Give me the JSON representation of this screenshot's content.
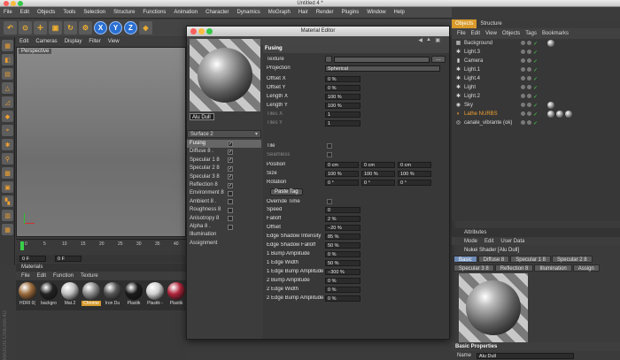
{
  "window": {
    "title": "Untitled 4 *"
  },
  "menubar": [
    "File",
    "Edit",
    "Objects",
    "Tools",
    "Selection",
    "Structure",
    "Functions",
    "Animation",
    "Character",
    "Dynamics",
    "MoGraph",
    "Hair",
    "Render",
    "Plugins",
    "Window",
    "Help"
  ],
  "toolbar": {
    "axis_x": "X",
    "axis_y": "Y",
    "axis_z": "Z"
  },
  "viewport": {
    "menu": [
      "Edit",
      "Cameras",
      "Display",
      "Filter",
      "View"
    ],
    "label": "Perspective"
  },
  "timeline": {
    "ticks": [
      "0",
      "5",
      "10",
      "15",
      "20",
      "25",
      "30",
      "35",
      "40"
    ],
    "frame_start": "0 F",
    "frame_current": "0 F"
  },
  "materials": {
    "title": "Materials",
    "menu": [
      "File",
      "Edit",
      "Function",
      "Texture"
    ],
    "items": [
      {
        "name": "HDRI 0(",
        "color": "#9a6a3a"
      },
      {
        "name": "backgro",
        "color": "#222222"
      },
      {
        "name": "Mat.2",
        "color": "#bfbfbf"
      },
      {
        "name": "Chrome",
        "color": "#8a8a8a"
      },
      {
        "name": "Iron Du",
        "color": "#555555"
      },
      {
        "name": "Plastik",
        "color": "#1a1a1a"
      },
      {
        "name": "Plastik -",
        "color": "#d0d0d0"
      },
      {
        "name": "Plastik",
        "color": "#b0243a"
      }
    ],
    "selected": "Chrome"
  },
  "side_label": "MAXON CINEMA 4D",
  "material_editor": {
    "title": "Material Editor",
    "material_name": "Alu Dull",
    "surface": "Surface 2",
    "channels": [
      {
        "label": "Fusing",
        "checked": true,
        "selected": true
      },
      {
        "label": "Diffuse 8 .",
        "checked": true
      },
      {
        "label": "Specular 1 8",
        "checked": true
      },
      {
        "label": "Specular 2 8",
        "checked": true
      },
      {
        "label": "Specular 3 8",
        "checked": true
      },
      {
        "label": "Reflection 8",
        "checked": true
      },
      {
        "label": "Environment 8",
        "checked": false
      },
      {
        "label": "Ambient 8 .",
        "checked": false
      },
      {
        "label": "Roughness 8",
        "checked": false
      },
      {
        "label": "Anisotropy 8",
        "checked": false
      },
      {
        "label": "Alpha 8 .",
        "checked": false
      },
      {
        "label": "Illumination",
        "checked": null
      },
      {
        "label": "Assignment",
        "checked": null
      }
    ],
    "section": "Fusing",
    "props": {
      "texture": "Texture",
      "projection_label": "Projection",
      "projection_value": "Spherical",
      "offset_x": "Offset X",
      "offset_x_v": "0 %",
      "offset_y": "Offset Y",
      "offset_y_v": "0 %",
      "length_x": "Length X",
      "length_x_v": "100 %",
      "length_y": "Length Y",
      "length_y_v": "100 %",
      "tiles_x": "Tiles X",
      "tiles_x_v": "1",
      "tiles_y": "Tiles Y",
      "tiles_y_v": "1",
      "tile": "Tile",
      "seamless": "Seamless",
      "position": "Position",
      "pos_x": "0 cm",
      "pos_y": "0 cm",
      "pos_z": "0 cm",
      "size": "Size",
      "size_x": "100 %",
      "size_y": "100 %",
      "size_z": "100 %",
      "rotation": "Rotation",
      "rot_x": "0 °",
      "rot_y": "0 °",
      "rot_z": "0 °",
      "paste_tag": "Paste Tag",
      "override_time": "Override Time",
      "speed": "Speed",
      "speed_v": "0",
      "falloff": "Falloff",
      "falloff_v": "2 %",
      "offset": "Offset",
      "offset_v": "−20 %",
      "esi": "Edge Shadow Intensity",
      "esi_v": "85 %",
      "esf": "Edge Shadow Falloff",
      "esf_v": "50 %",
      "b1a": "1 Bump Amplitude",
      "b1a_v": "0 %",
      "e1w": "1 Edge Width",
      "e1w_v": "50 %",
      "e1b": "1 Edge Bump Amplitude",
      "e1b_v": "−300 %",
      "b2a": "2 Bump Amplitude",
      "b2a_v": "0 %",
      "e2w": "2 Edge Width",
      "e2w_v": "0 %",
      "e2b": "2 Edge Bump Amplitude",
      "e2b_v": "0 %"
    }
  },
  "objects": {
    "tabs": [
      "Objects",
      "Structure"
    ],
    "menu": [
      "File",
      "Edit",
      "View",
      "Objects",
      "Tags",
      "Bookmarks"
    ],
    "rows": [
      {
        "name": "Background",
        "icon": "background-icon",
        "color": "#d8d8d8"
      },
      {
        "name": "Light.3",
        "icon": "light-icon",
        "color": "#d8d8d8"
      },
      {
        "name": "Camera",
        "icon": "camera-icon",
        "color": "#d8d8d8"
      },
      {
        "name": "Light.1",
        "icon": "light-icon",
        "color": "#d8d8d8"
      },
      {
        "name": "Light.4",
        "icon": "light-icon",
        "color": "#d8d8d8"
      },
      {
        "name": "Light",
        "icon": "light-icon",
        "color": "#d8d8d8"
      },
      {
        "name": "Light.2",
        "icon": "light-icon",
        "color": "#d8d8d8"
      },
      {
        "name": "Sky",
        "icon": "sky-icon",
        "color": "#d8d8d8"
      },
      {
        "name": "Lathe NURBS",
        "icon": "lathe-icon",
        "color": "#f0a030"
      },
      {
        "name": "canale_vibrante (ok)",
        "icon": "group-icon",
        "color": "#d8d8d8"
      }
    ]
  },
  "attributes": {
    "title": "Attributes",
    "menu": [
      "Mode",
      "Edit",
      "User Data"
    ],
    "object_name": "Nukei Shader [Alu Dull]",
    "tabs": [
      "Basic",
      "Diffuse 8",
      "Specular 1 8",
      "Specular 2 8",
      "Specular 3 8",
      "Reflection 8",
      "Illumination",
      "Assign"
    ],
    "active_tab": "Basic",
    "basic_properties": "Basic Properties",
    "name_label": "Name",
    "name_value": "Alu Dull"
  }
}
